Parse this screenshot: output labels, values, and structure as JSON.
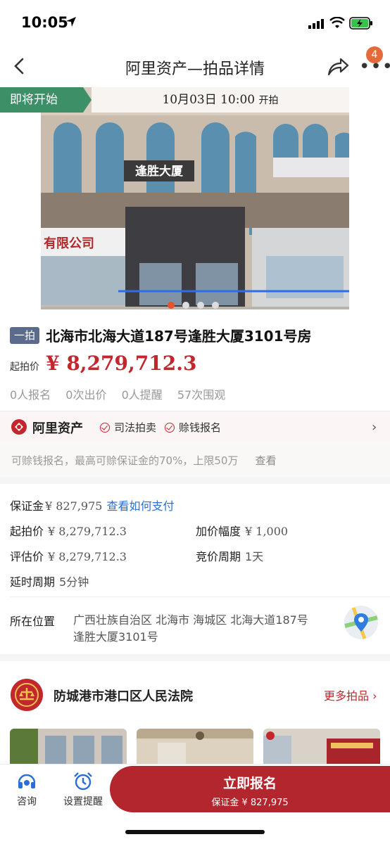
{
  "status_bar": {
    "time": "10:05"
  },
  "nav": {
    "title": "阿里资产—拍品详情",
    "badge_count": "4"
  },
  "hero": {
    "status_tag": "即将开始",
    "start_date": "10月03日 10:00",
    "start_suffix": "开拍",
    "building_sign": "逢胜大厦",
    "shop_sign": "有限公司",
    "slide_count": 4,
    "active_slide": 0
  },
  "lot": {
    "round_tag": "一拍",
    "title": "北海市北海大道187号逢胜大厦3101号房",
    "start_price_label": "起拍价",
    "start_price": "¥ 8,279,712.3",
    "stats": [
      "0人报名",
      "0次出价",
      "0人提醒",
      "57次围观"
    ]
  },
  "ali": {
    "brand": "阿里资产",
    "tag1": "司法拍卖",
    "tag2": "赊钱报名",
    "note": "可赊钱报名，最高可赊保证金的70%，上限50万",
    "note_link": "查看"
  },
  "details": {
    "deposit_label": "保证金",
    "deposit_value": "¥ 827,975",
    "deposit_link": "查看如何支付",
    "start_label": "起拍价",
    "start_value": "¥ 8,279,712.3",
    "increment_label": "加价幅度",
    "increment_value": "¥ 1,000",
    "appraisal_label": "评估价",
    "appraisal_value": "¥ 8,279,712.3",
    "period_label": "竞价周期",
    "period_value": "1天",
    "delay_label": "延时周期",
    "delay_value": "5分钟",
    "location_label": "所在位置",
    "location_value": "广西壮族自治区 北海市 海城区 北海大道187号逢胜大厦3101号"
  },
  "court": {
    "name": "防城港市港口区人民法院",
    "more": "更多拍品"
  },
  "bottom": {
    "consult": "咨询",
    "remind": "设置提醒",
    "signup": "立即报名",
    "signup_deposit": "保证金 ¥ 827,975"
  },
  "colors": {
    "accent": "#b3262d",
    "price": "#c1272d",
    "tag_green": "#3d8f68",
    "link": "#2b6fd4"
  }
}
